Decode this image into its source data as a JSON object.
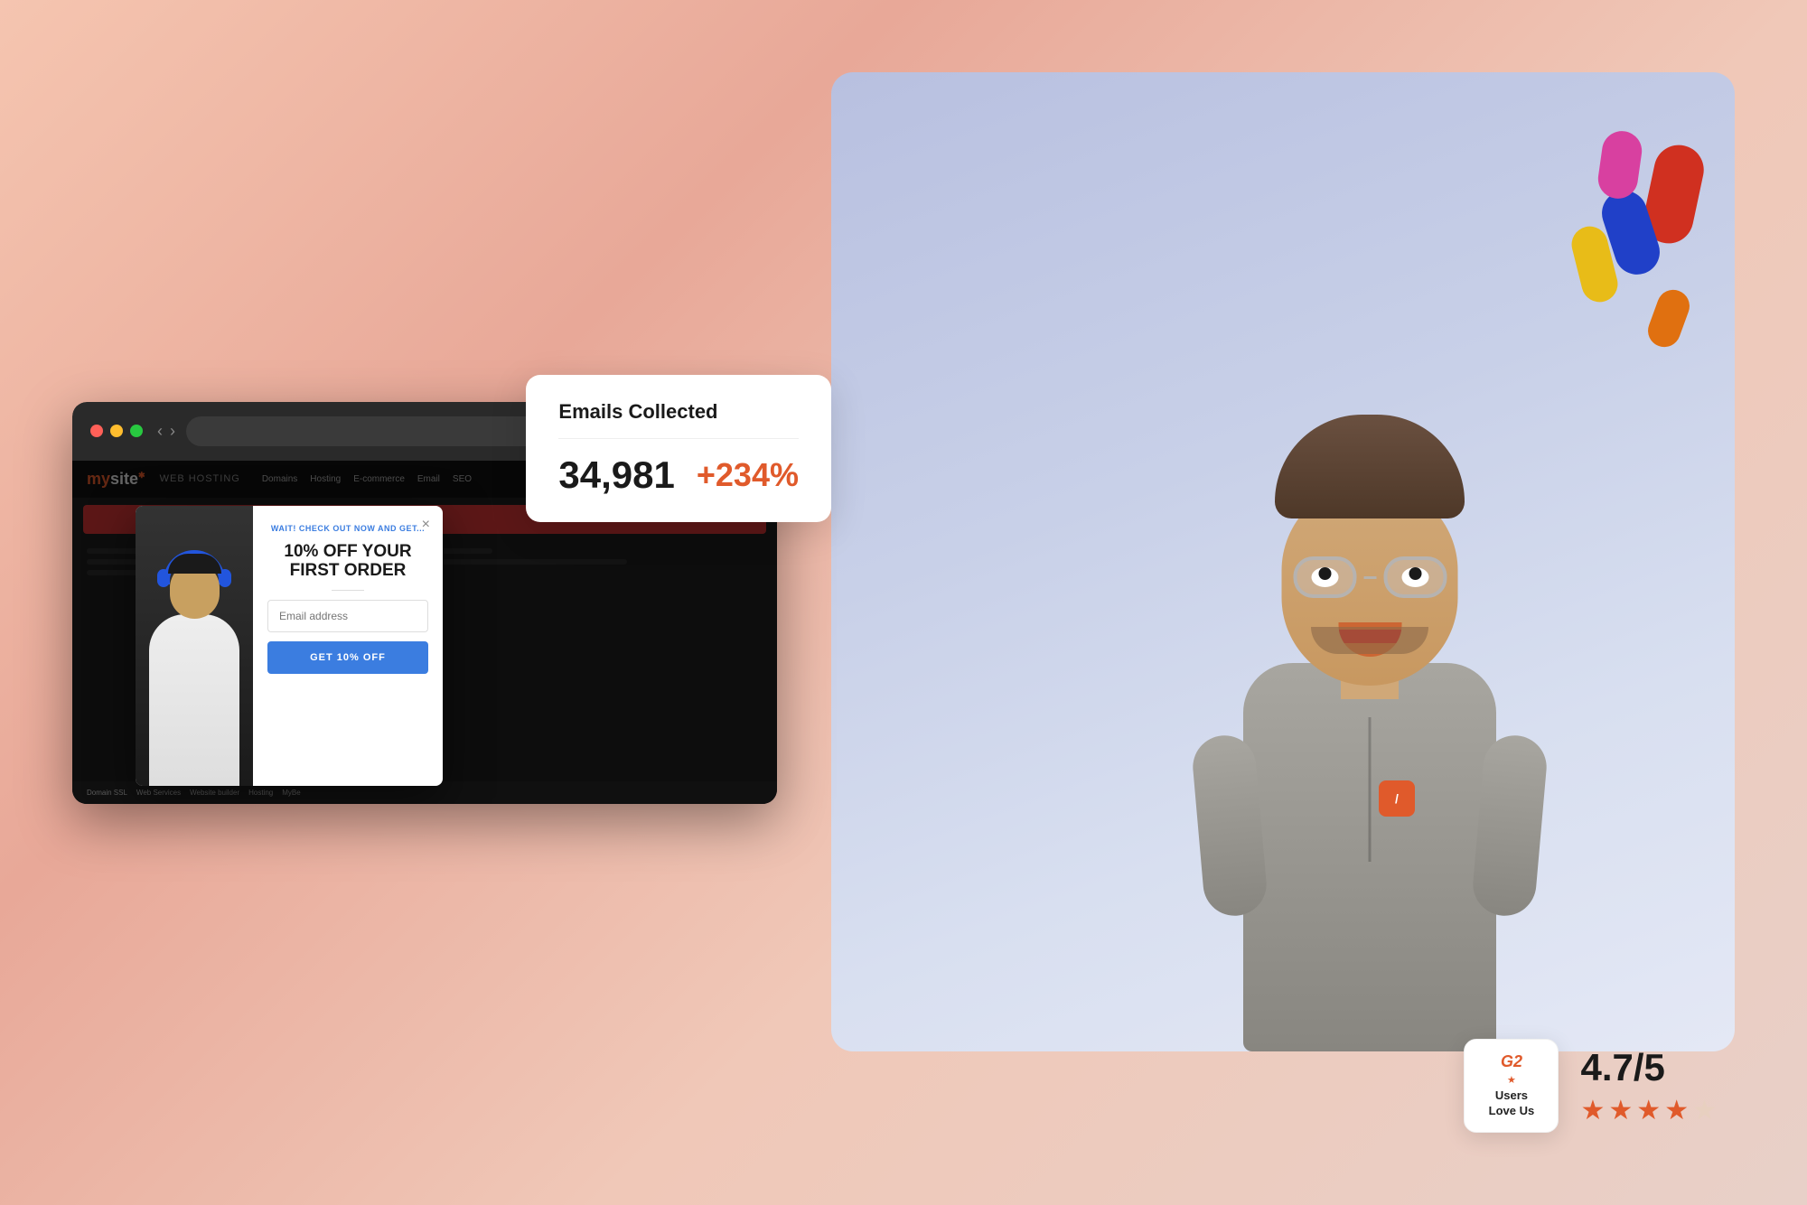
{
  "stats_card": {
    "title": "Emails Collected",
    "number": "34,981",
    "percent": "+234%"
  },
  "browser": {
    "address_placeholder": ""
  },
  "popup": {
    "eyebrow": "WAIT! CHECK OUT NOW AND GET...",
    "heading_line1": "10% OFF YOUR",
    "heading_line2": "FIRST ORDER",
    "email_placeholder": "Email address",
    "cta_label": "GET 10% OFF",
    "close_label": "×"
  },
  "rating": {
    "badge_g2": "G2",
    "badge_star": "★",
    "badge_users_love_us": "Users\nLove Us",
    "score": "4.7/5",
    "stars_count": 4
  },
  "site": {
    "logo": "mysite",
    "nav_label": "WEB HOSTING",
    "nav_items": [
      "Domains",
      "Hosting",
      "E-commerce",
      "Email",
      "SEO"
    ]
  }
}
